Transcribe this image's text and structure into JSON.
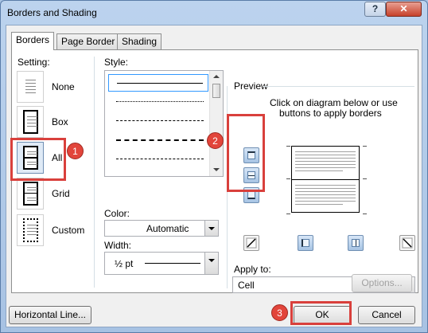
{
  "window": {
    "title": "Borders and Shading",
    "help_glyph": "?",
    "close_glyph": "✕"
  },
  "tabs": [
    {
      "label": "Borders",
      "active": true
    },
    {
      "label": "Page Border",
      "active": false
    },
    {
      "label": "Shading",
      "active": false
    }
  ],
  "setting": {
    "label": "Setting:",
    "items": [
      {
        "label": "None",
        "icon": "setting-none-icon"
      },
      {
        "label": "Box",
        "icon": "setting-box-icon"
      },
      {
        "label": "All",
        "icon": "setting-all-icon",
        "selected": true
      },
      {
        "label": "Grid",
        "icon": "setting-grid-icon"
      },
      {
        "label": "Custom",
        "icon": "setting-custom-icon"
      }
    ]
  },
  "style": {
    "label": "Style:",
    "options": [
      "solid",
      "dotted",
      "dashed",
      "long-dashed",
      "dash-dot"
    ]
  },
  "color": {
    "label": "Color:",
    "value": "Automatic"
  },
  "width": {
    "label": "Width:",
    "value": "½ pt"
  },
  "preview": {
    "label": "Preview",
    "instructions_line1": "Click on diagram below or use",
    "instructions_line2": "buttons to apply borders"
  },
  "apply_to": {
    "label": "Apply to:",
    "value": "Cell"
  },
  "buttons": {
    "options": "Options...",
    "horizontal_line": "Horizontal Line...",
    "ok": "OK",
    "cancel": "Cancel"
  },
  "callouts": [
    "1",
    "2",
    "3"
  ],
  "colors": {
    "callout": "#e2453b",
    "highlight_box": "#d9403c",
    "border_button": "#a6c3e3"
  }
}
